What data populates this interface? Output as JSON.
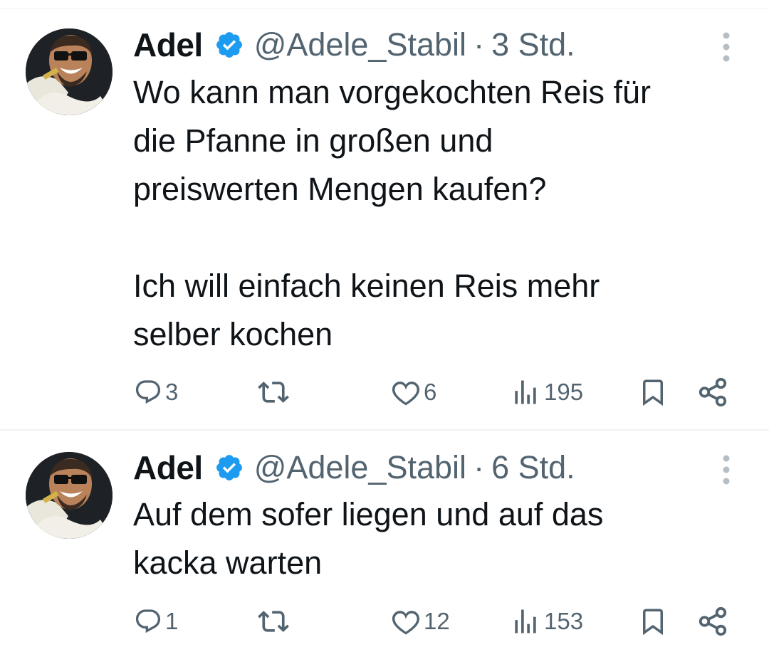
{
  "tweets": [
    {
      "author_name": "Adel",
      "handle": "@Adele_Stabil",
      "separator": "·",
      "time": "3 Std.",
      "text": "Wo kann man vorgekochten Reis für\ndie Pfanne in großen und\npreiswerten Mengen kaufen?\n\nIch will einfach keinen Reis mehr\nselber kochen",
      "replies": "3",
      "retweets": "",
      "likes": "6",
      "views": "195"
    },
    {
      "author_name": "Adel",
      "handle": "@Adele_Stabil",
      "separator": "·",
      "time": "6 Std.",
      "text": "Auf dem sofer liegen und auf das\nkacka warten",
      "replies": "1",
      "retweets": "",
      "likes": "12",
      "views": "153"
    }
  ],
  "icons": [
    "reply-icon",
    "retweet-icon",
    "like-icon",
    "views-icon",
    "bookmark-icon",
    "share-icon",
    "more-icon",
    "verified-badge-icon"
  ],
  "colors": {
    "verified": "#1d9bf0",
    "text": "#0f1419",
    "secondary": "#536471",
    "divider": "#eff3f4"
  }
}
